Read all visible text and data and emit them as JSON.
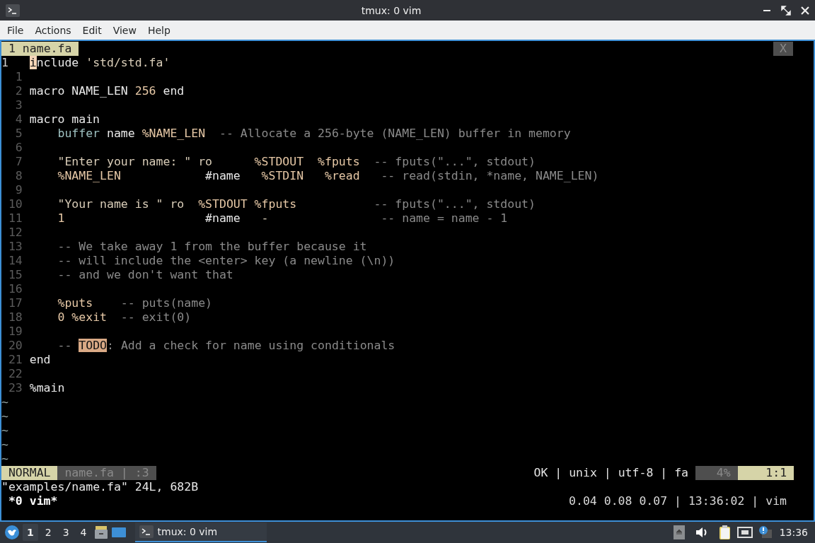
{
  "window": {
    "title": "tmux: 0 vim"
  },
  "menu": [
    "File",
    "Actions",
    "Edit",
    "View",
    "Help"
  ],
  "tabline": {
    "tabs": [
      {
        "label": "1 name.fa",
        "selected": true
      }
    ],
    "close": "X"
  },
  "editor": {
    "lines": [
      {
        "number": "1",
        "current": true,
        "tokens": [
          {
            "kind": "cursor",
            "text": "i"
          },
          {
            "kind": "text",
            "text": "nclude"
          },
          {
            "kind": "string",
            "text": " 'std/std.fa'"
          }
        ]
      },
      {
        "number": "1",
        "current": false
      },
      {
        "number": "2",
        "current": false,
        "tokens": [
          {
            "kind": "text",
            "text": "macro NAME_LEN "
          },
          {
            "kind": "number",
            "text": "256"
          },
          {
            "kind": "text",
            "text": " end"
          }
        ]
      },
      {
        "number": "3",
        "current": false
      },
      {
        "number": "4",
        "current": false,
        "tokens": [
          {
            "kind": "text",
            "text": "macro main"
          }
        ]
      },
      {
        "number": "5",
        "current": false,
        "tokens": [
          {
            "kind": "keyword",
            "text": "    buffer"
          },
          {
            "kind": "text",
            "text": " name "
          },
          {
            "kind": "macro",
            "text": "%NAME_LEN"
          },
          {
            "kind": "comment",
            "text": "  -- Allocate a 256-byte (NAME_LEN) buffer in memory"
          }
        ]
      },
      {
        "number": "6",
        "current": false
      },
      {
        "number": "7",
        "current": false,
        "tokens": [
          {
            "kind": "string",
            "text": "    \"Enter your name: \" ro      "
          },
          {
            "kind": "macro",
            "text": "%STDOUT  %fputs"
          },
          {
            "kind": "comment",
            "text": "  -- fputs(\"...\", stdout)"
          }
        ]
      },
      {
        "number": "8",
        "current": false,
        "tokens": [
          {
            "kind": "macro",
            "text": "    %NAME_LEN"
          },
          {
            "kind": "text",
            "text": "            #name   "
          },
          {
            "kind": "macro",
            "text": "%STDIN   %read"
          },
          {
            "kind": "comment",
            "text": "   -- read(stdin, *name, NAME_LEN)"
          }
        ]
      },
      {
        "number": "9",
        "current": false
      },
      {
        "number": "10",
        "current": false,
        "tokens": [
          {
            "kind": "string",
            "text": "    \"Your name is \" ro  "
          },
          {
            "kind": "macro",
            "text": "%STDOUT %fputs"
          },
          {
            "kind": "comment",
            "text": "           -- fputs(\"...\", stdout)"
          }
        ]
      },
      {
        "number": "11",
        "current": false,
        "tokens": [
          {
            "kind": "number",
            "text": "    1"
          },
          {
            "kind": "text",
            "text": "                    #name   "
          },
          {
            "kind": "string",
            "text": "-"
          },
          {
            "kind": "comment",
            "text": "                -- name = name - 1"
          }
        ]
      },
      {
        "number": "12",
        "current": false
      },
      {
        "number": "13",
        "current": false,
        "tokens": [
          {
            "kind": "comment",
            "text": "    -- We take away 1 from the buffer because it"
          }
        ]
      },
      {
        "number": "14",
        "current": false,
        "tokens": [
          {
            "kind": "comment",
            "text": "    -- will include the <enter> key (a newline (\\n))"
          }
        ]
      },
      {
        "number": "15",
        "current": false,
        "tokens": [
          {
            "kind": "comment",
            "text": "    -- and we don't want that"
          }
        ]
      },
      {
        "number": "16",
        "current": false
      },
      {
        "number": "17",
        "current": false,
        "tokens": [
          {
            "kind": "macro",
            "text": "    %puts"
          },
          {
            "kind": "comment",
            "text": "    -- puts(name)"
          }
        ]
      },
      {
        "number": "18",
        "current": false,
        "tokens": [
          {
            "kind": "number",
            "text": "    0 "
          },
          {
            "kind": "macro",
            "text": "%exit"
          },
          {
            "kind": "comment",
            "text": "  -- exit(0)"
          }
        ]
      },
      {
        "number": "19",
        "current": false
      },
      {
        "number": "20",
        "current": false,
        "tokens": [
          {
            "kind": "comment",
            "text": "    -- "
          },
          {
            "kind": "todo",
            "text": "TODO"
          },
          {
            "kind": "comment",
            "text": ": Add a check for name using conditionals"
          }
        ]
      },
      {
        "number": "21",
        "current": false,
        "tokens": [
          {
            "kind": "text",
            "text": "end"
          }
        ]
      },
      {
        "number": "22",
        "current": false
      },
      {
        "number": "23",
        "current": false,
        "tokens": [
          {
            "kind": "text",
            "text": "%main"
          }
        ]
      }
    ],
    "tildes": [
      "~",
      "~",
      "~",
      "~",
      "~"
    ]
  },
  "statusline": {
    "mode": "NORMAL",
    "file": "name.fa | :3",
    "info": "OK | unix | utf-8 | fa",
    "percent": "4%",
    "position": "1:1"
  },
  "message": "\"examples/name.fa\" 24L, 682B",
  "tmux": {
    "window": "*0 vim*",
    "status": "0.04 0.08 0.07 | 13:36:02 | vim"
  },
  "taskbar": {
    "workspaces": [
      {
        "label": "1",
        "selected": true
      },
      {
        "label": "2",
        "selected": false
      },
      {
        "label": "3",
        "selected": false
      },
      {
        "label": "4",
        "selected": false
      }
    ],
    "task": {
      "label": "tmux: 0 vim",
      "active": true
    },
    "clock": "13:36"
  }
}
